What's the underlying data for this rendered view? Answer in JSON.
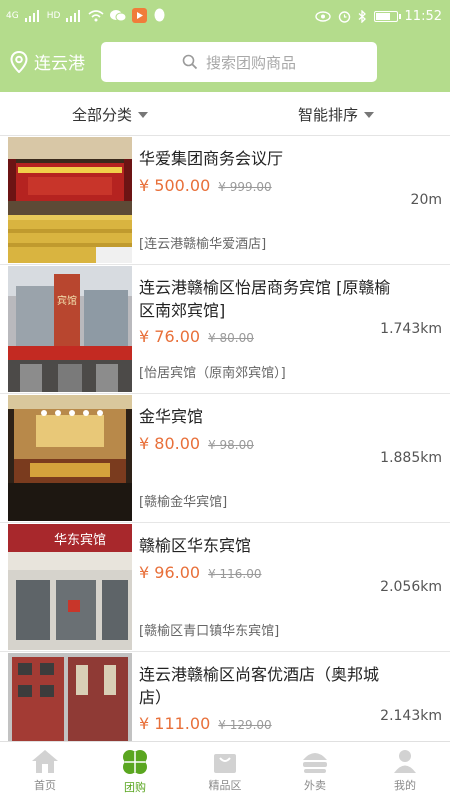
{
  "status_bar": {
    "time": "11:52",
    "network_left": "4G",
    "network_right": "HD"
  },
  "header": {
    "city": "连云港",
    "search_placeholder": "搜索团购商品"
  },
  "filters": {
    "category": "全部分类",
    "sort": "智能排序"
  },
  "items": [
    {
      "name": "华爱集团商务会议厅",
      "price": "¥ 500.00",
      "original": "¥ 999.00",
      "distance": "20m",
      "address": "[连云港赣榆华爱酒店]"
    },
    {
      "name": "连云港赣榆区怡居商务宾馆 [原赣榆区南郊宾馆]",
      "price": "¥ 76.00",
      "original": "¥ 80.00",
      "distance": "1.743km",
      "address": "[怡居宾馆（原南郊宾馆）]"
    },
    {
      "name": "金华宾馆",
      "price": "¥ 80.00",
      "original": "¥ 98.00",
      "distance": "1.885km",
      "address": "[赣榆金华宾馆]"
    },
    {
      "name": "赣榆区华东宾馆",
      "price": "¥ 96.00",
      "original": "¥ 116.00",
      "distance": "2.056km",
      "address": "[赣榆区青口镇华东宾馆]"
    },
    {
      "name": "连云港赣榆区尚客优酒店（奥邦城店）",
      "price": "¥ 111.00",
      "original": "¥ 129.00",
      "distance": "2.143km",
      "address": ""
    }
  ],
  "thumb_text": {
    "hotel_sign_2": "宾馆",
    "hotel_sign_4": "华东宾馆"
  },
  "tabs": [
    {
      "label": "首页",
      "icon": "home-icon"
    },
    {
      "label": "团购",
      "icon": "clover-icon",
      "active": true
    },
    {
      "label": "精品区",
      "icon": "shopping-bag-icon"
    },
    {
      "label": "外卖",
      "icon": "takeaway-icon"
    },
    {
      "label": "我的",
      "icon": "profile-icon"
    }
  ],
  "colors": {
    "header_green": "#b4dc8c",
    "price_orange": "#e8703a",
    "active_tab": "#58a51e"
  }
}
